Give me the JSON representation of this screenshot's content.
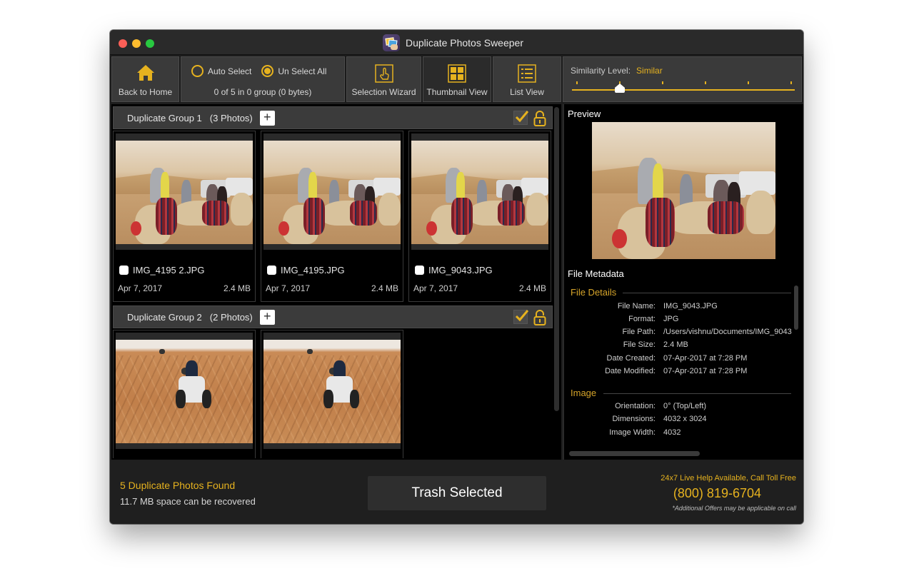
{
  "window": {
    "title": "Duplicate Photos Sweeper",
    "app_icon": "duplicate-photos-sweeper-app-icon"
  },
  "toolbar": {
    "back_home": {
      "label": "Back to Home",
      "icon": "home-icon"
    },
    "auto_select": {
      "label": "Auto Select",
      "selected": false
    },
    "unselect_all": {
      "label": "Un Select All",
      "selected": true
    },
    "selection_summary": "0 of 5 in 0 group (0 bytes)",
    "selection_wizard": {
      "label": "Selection Wizard",
      "icon": "hand-pointer-icon"
    },
    "thumbnail_view": {
      "label": "Thumbnail View",
      "icon": "grid-icon",
      "active": true
    },
    "list_view": {
      "label": "List View",
      "icon": "list-icon"
    },
    "similarity": {
      "label": "Similarity Level:",
      "value": "Similar",
      "levels": 6,
      "selected_index": 1
    }
  },
  "groups": [
    {
      "title": "Duplicate Group 1",
      "count": "(3 Photos)",
      "photos": [
        {
          "name": "IMG_4195 2.JPG",
          "date": "Apr 7, 2017",
          "size": "2.4 MB",
          "checked": false,
          "scene": "camel"
        },
        {
          "name": "IMG_4195.JPG",
          "date": "Apr 7, 2017",
          "size": "2.4 MB",
          "checked": false,
          "scene": "camel"
        },
        {
          "name": "IMG_9043.JPG",
          "date": "Apr 7, 2017",
          "size": "2.4 MB",
          "checked": false,
          "scene": "camel"
        }
      ]
    },
    {
      "title": "Duplicate Group 2",
      "count": "(2 Photos)",
      "photos": [
        {
          "scene": "atv"
        },
        {
          "scene": "atv"
        }
      ]
    }
  ],
  "preview": {
    "title": "Preview",
    "metadata_title": "File Metadata",
    "sections": [
      {
        "title": "File Details",
        "rows": [
          {
            "key": "File Name:",
            "value": "IMG_9043.JPG"
          },
          {
            "key": "Format:",
            "value": "JPG"
          },
          {
            "key": "File Path:",
            "value": "/Users/vishnu/Documents/IMG_9043"
          },
          {
            "key": "File Size:",
            "value": "2.4 MB"
          },
          {
            "key": "Date Created:",
            "value": "07-Apr-2017 at 7:28 PM"
          },
          {
            "key": "Date Modified:",
            "value": "07-Apr-2017 at 7:28 PM"
          }
        ]
      },
      {
        "title": "Image",
        "rows": [
          {
            "key": "Orientation:",
            "value": "0° (Top/Left)"
          },
          {
            "key": "Dimensions:",
            "value": "4032 x 3024"
          },
          {
            "key": "Image Width:",
            "value": "4032"
          }
        ]
      }
    ]
  },
  "footer": {
    "found": "5 Duplicate Photos Found",
    "recoverable": "11.7 MB space can be recovered",
    "trash_label": "Trash Selected",
    "help_text": "24x7 Live Help Available, Call Toll Free",
    "phone": "(800) 819-6704",
    "note": "*Additional Offers may be applicable on call"
  },
  "colors": {
    "accent": "#e6b21f",
    "section_title": "#d6a42a",
    "toolbar_button": "#3a3a3a",
    "background": "#000000"
  }
}
